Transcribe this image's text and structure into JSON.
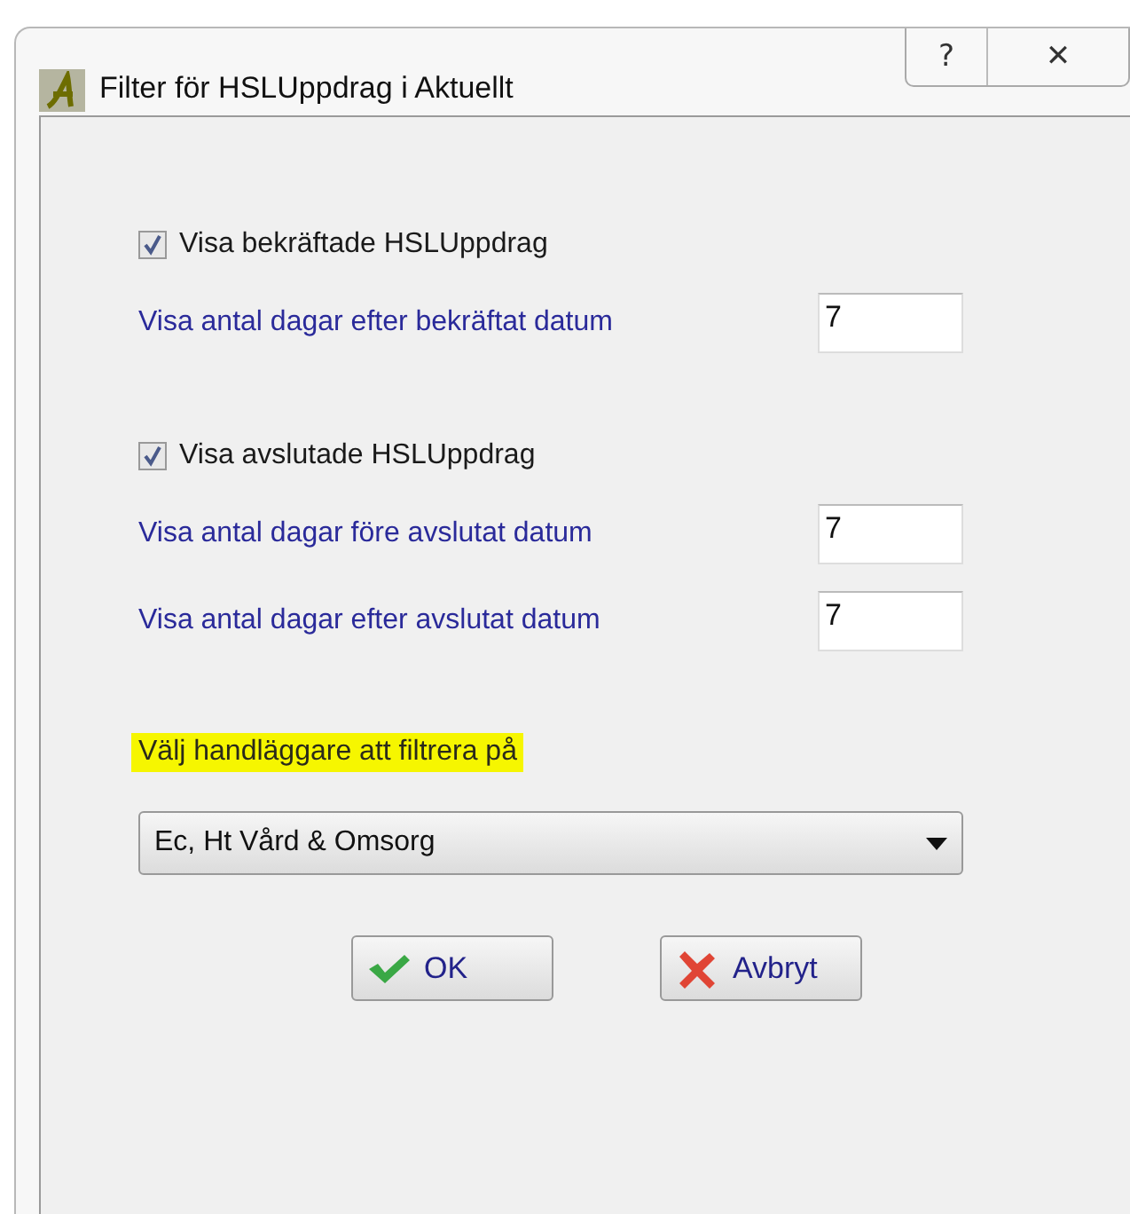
{
  "window": {
    "title": "Filter för HSLUppdrag i Aktuellt",
    "controls": [
      "?",
      "✕"
    ]
  },
  "sections": [
    {
      "checkbox": {
        "label": "Visa bekräftade HSLUppdrag",
        "checked": true
      },
      "fields": [
        {
          "label": "Visa antal dagar efter bekräftat datum",
          "value": "7"
        }
      ]
    },
    {
      "checkbox": {
        "label": "Visa avslutade HSLUppdrag",
        "checked": true
      },
      "fields": [
        {
          "label": "Visa antal dagar före avslutat datum",
          "value": "7"
        },
        {
          "label": "Visa antal dagar efter avslutat datum",
          "value": "7"
        }
      ]
    }
  ],
  "handler": {
    "label": "Välj handläggare att filtrera på",
    "highlighted": true,
    "value": "Ec, Ht Vård & Omsorg"
  },
  "buttons": [
    {
      "kind": "ok",
      "label": "OK"
    },
    {
      "kind": "cancel",
      "label": "Avbryt"
    }
  ]
}
